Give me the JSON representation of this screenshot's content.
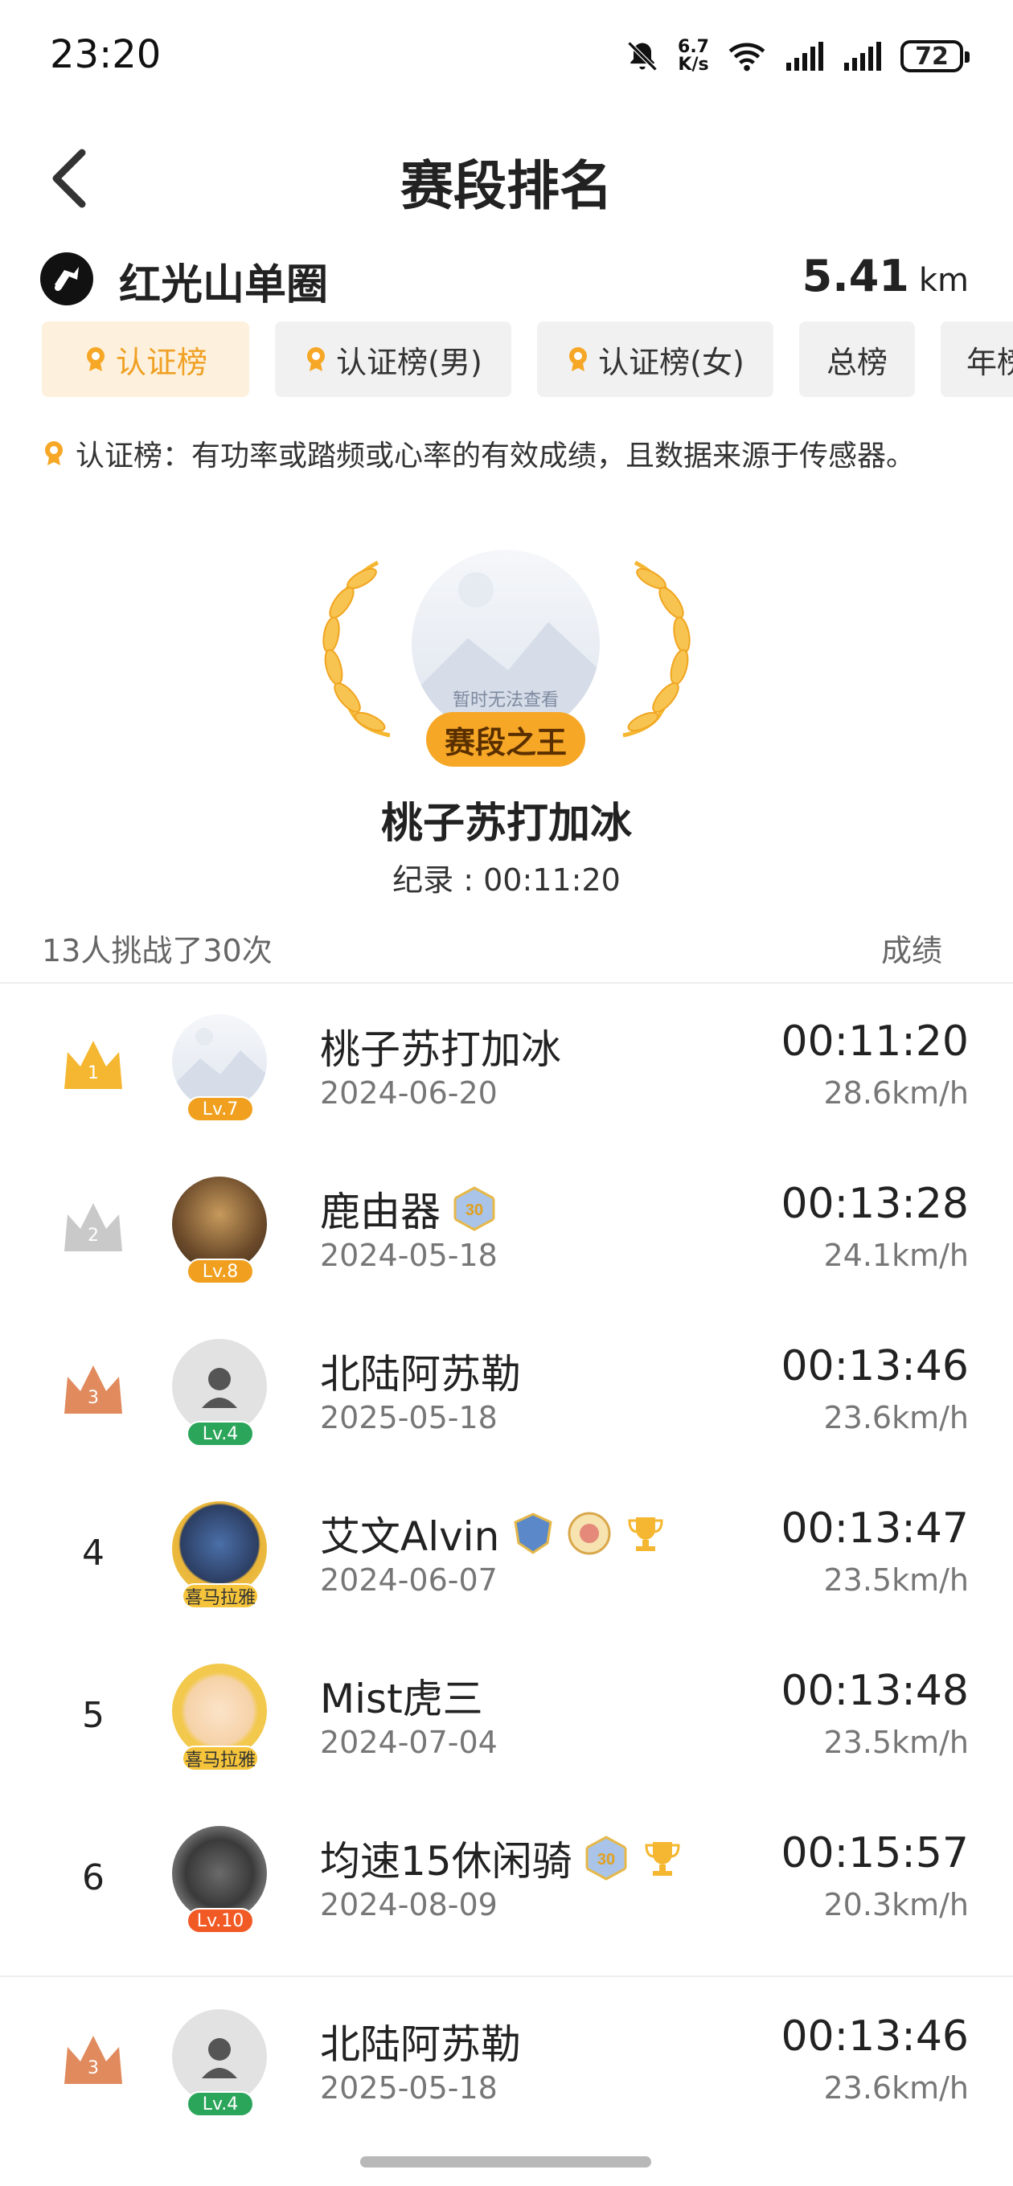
{
  "status_bar": {
    "time": "23:20",
    "net_speed_value": "6.7",
    "net_speed_unit": "K/s",
    "battery": "72"
  },
  "header": {
    "title": "赛段排名"
  },
  "segment": {
    "name": "红光山单圈",
    "distance_value": "5.41",
    "distance_unit": "km"
  },
  "tabs": [
    {
      "label": "认证榜",
      "active": true,
      "medal": true
    },
    {
      "label": "认证榜(男)",
      "active": false,
      "medal": true
    },
    {
      "label": "认证榜(女)",
      "active": false,
      "medal": true
    },
    {
      "label": "总榜",
      "active": false,
      "medal": false
    },
    {
      "label": "年榜",
      "active": false,
      "medal": false
    }
  ],
  "note": "认证榜：有功率或踏频或心率的有效成绩，且数据来源于传感器。",
  "champion": {
    "avatar_placeholder": "暂时无法查看",
    "title": "赛段之王",
    "name": "桃子苏打加冰",
    "record": "纪录 : 00:11:20"
  },
  "summary": {
    "challenges": "13人挑战了30次",
    "column_label": "成绩"
  },
  "colors": {
    "accent": "#f6a726",
    "gold": "#f5b731",
    "silver": "#c9c9c9",
    "bronze": "#e08a5e"
  },
  "rows": [
    {
      "rank": "1",
      "crown": "gold",
      "name": "桃子苏打加冰",
      "date": "2024-06-20",
      "time": "00:11:20",
      "speed": "28.6km/h",
      "level": "Lv.7",
      "badges": []
    },
    {
      "rank": "2",
      "crown": "silver",
      "name": "鹿由器",
      "date": "2024-05-18",
      "time": "00:13:28",
      "speed": "24.1km/h",
      "level": "Lv.8",
      "badges": [
        "30-badge"
      ]
    },
    {
      "rank": "3",
      "crown": "bronze",
      "name": "北陆阿苏勒",
      "date": "2025-05-18",
      "time": "00:13:46",
      "speed": "23.6km/h",
      "level": "Lv.4",
      "badges": []
    },
    {
      "rank": "4",
      "crown": "",
      "name": "艾文Alvin",
      "date": "2024-06-07",
      "time": "00:13:47",
      "speed": "23.5km/h",
      "level": "喜马拉雅",
      "badges": [
        "badge-a",
        "badge-b",
        "trophy"
      ]
    },
    {
      "rank": "5",
      "crown": "",
      "name": "Mist虎三",
      "date": "2024-07-04",
      "time": "00:13:48",
      "speed": "23.5km/h",
      "level": "喜马拉雅",
      "badges": []
    },
    {
      "rank": "6",
      "crown": "",
      "name": "均速15休闲骑",
      "date": "2024-08-09",
      "time": "00:15:57",
      "speed": "20.3km/h",
      "level": "Lv.10",
      "badges": [
        "30-badge",
        "trophy"
      ]
    }
  ],
  "my_row": {
    "rank": "3",
    "crown": "bronze",
    "name": "北陆阿苏勒",
    "date": "2025-05-18",
    "time": "00:13:46",
    "speed": "23.6km/h",
    "level": "Lv.4"
  }
}
